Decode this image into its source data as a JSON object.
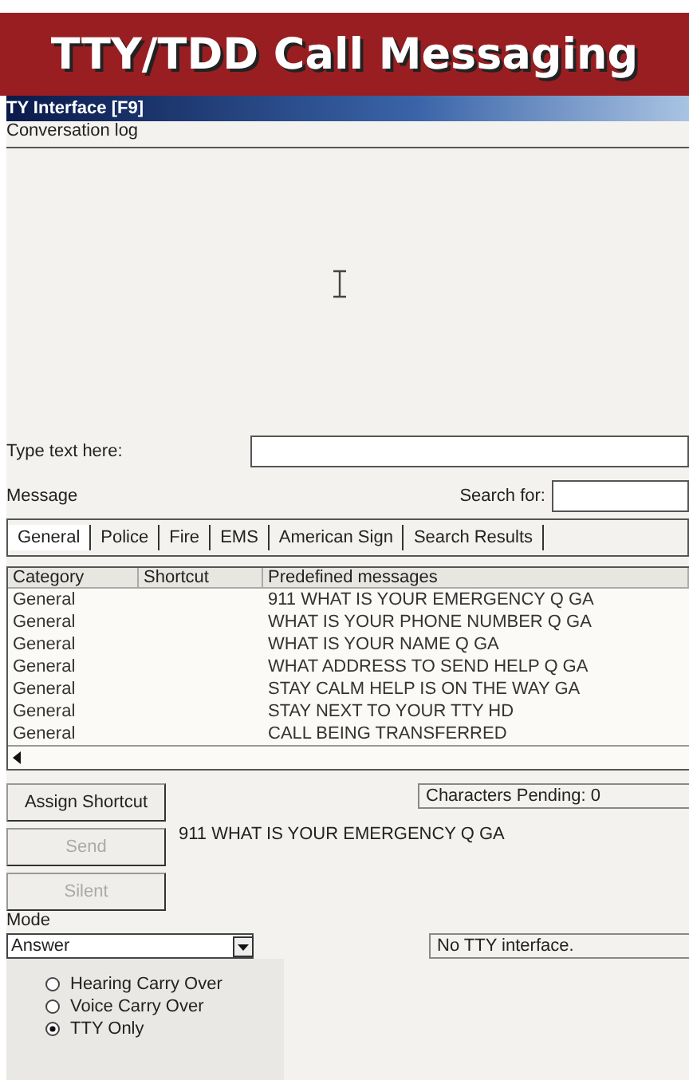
{
  "banner": {
    "title": "TTY/TDD Call Messaging"
  },
  "window": {
    "title": "TY Interface [F9]"
  },
  "log": {
    "label": "Conversation log"
  },
  "input": {
    "label": "Type text here:"
  },
  "message": {
    "label": "Message",
    "search_label": "Search for:"
  },
  "tabs": [
    {
      "label": "General",
      "selected": true
    },
    {
      "label": "Police",
      "selected": false
    },
    {
      "label": "Fire",
      "selected": false
    },
    {
      "label": "EMS",
      "selected": false
    },
    {
      "label": "American Sign",
      "selected": false
    },
    {
      "label": "Search Results",
      "selected": false
    }
  ],
  "table": {
    "columns": [
      "Category",
      "Shortcut",
      "Predefined messages"
    ],
    "rows": [
      [
        "General",
        "",
        "911 WHAT IS YOUR EMERGENCY Q GA"
      ],
      [
        "General",
        "",
        "WHAT IS YOUR PHONE NUMBER Q GA"
      ],
      [
        "General",
        "",
        "WHAT IS YOUR NAME Q GA"
      ],
      [
        "General",
        "",
        "WHAT ADDRESS TO SEND HELP Q GA"
      ],
      [
        "General",
        "",
        "STAY CALM HELP IS ON THE WAY GA"
      ],
      [
        "General",
        "",
        "STAY NEXT TO YOUR TTY HD"
      ],
      [
        "General",
        "",
        "CALL BEING TRANSFERRED"
      ]
    ]
  },
  "buttons": [
    {
      "label": "Assign Shortcut",
      "disabled": false
    },
    {
      "label": "Send",
      "disabled": true
    },
    {
      "label": "Silent",
      "disabled": true
    }
  ],
  "characters_pending": "Characters Pending: 0",
  "pending_message": "911 WHAT IS YOUR EMERGENCY Q GA",
  "mode": {
    "label": "Mode",
    "value": "Answer",
    "status": "No TTY interface."
  },
  "radios": [
    {
      "label": "Hearing Carry Over",
      "selected": false
    },
    {
      "label": "Voice Carry Over",
      "selected": false
    },
    {
      "label": "TTY Only",
      "selected": true
    }
  ]
}
